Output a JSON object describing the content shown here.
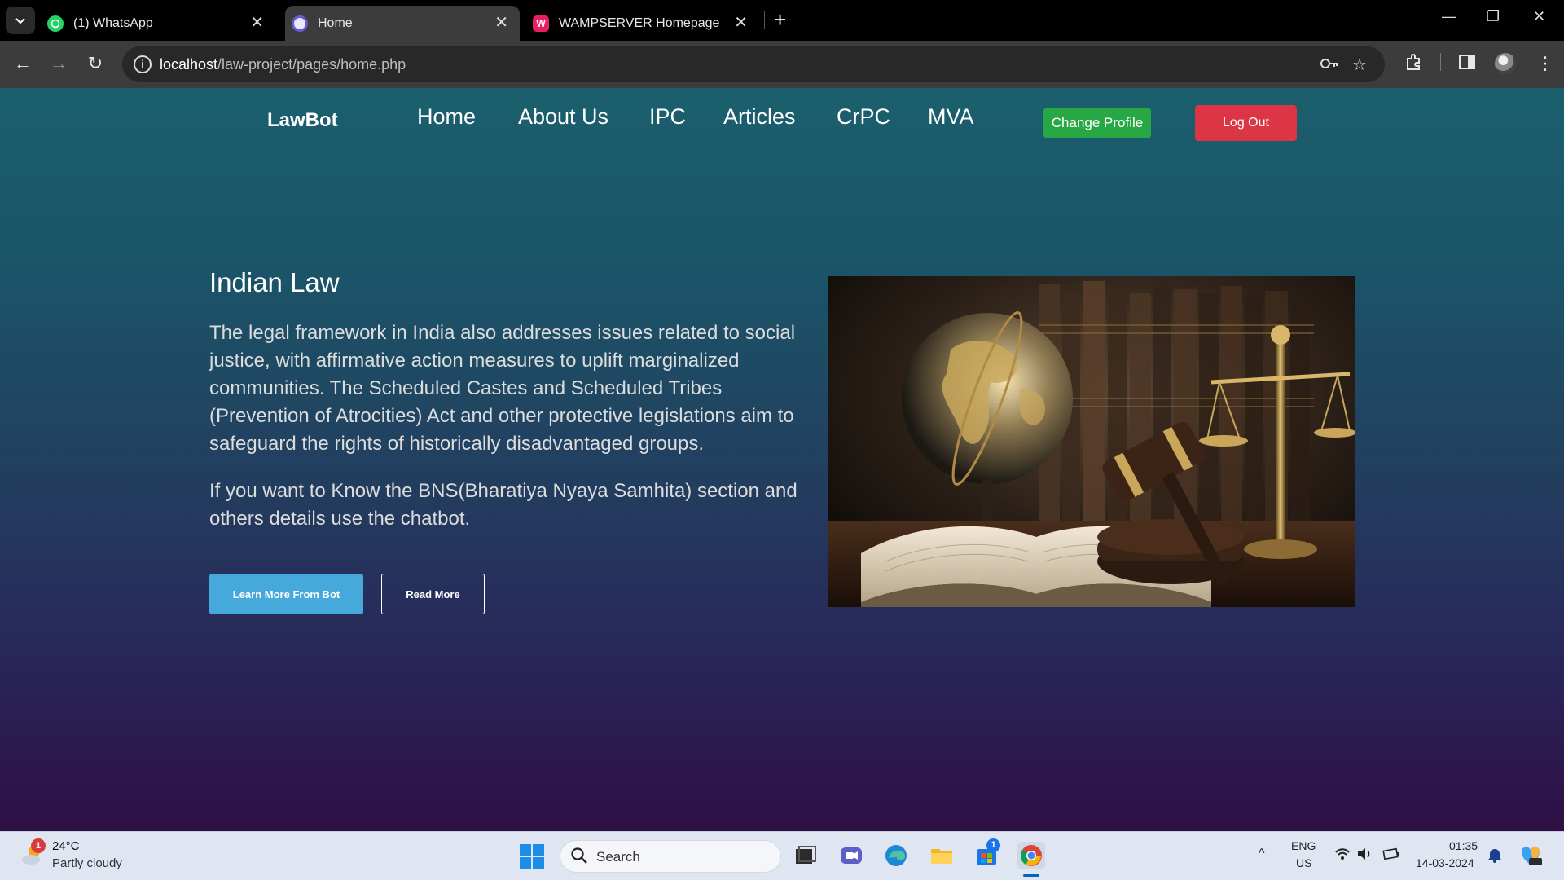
{
  "browser": {
    "tabs": [
      {
        "title": "(1) WhatsApp"
      },
      {
        "title": "Home"
      },
      {
        "title": "WAMPSERVER Homepage"
      }
    ],
    "url_host": "localhost",
    "url_path": "/law-project/pages/home.php"
  },
  "navbar": {
    "brand": "LawBot",
    "links": [
      "Home",
      "About Us",
      "IPC",
      "Articles",
      "CrPC",
      "MVA"
    ],
    "change_profile": "Change Profile",
    "logout": "Log Out"
  },
  "hero": {
    "title": "Indian Law",
    "paragraph1": "The legal framework in India also addresses issues related to social justice, with affirmative action measures to uplift marginalized communities. The Scheduled Castes and Scheduled Tribes (Prevention of Atrocities) Act and other protective legislations aim to safeguard the rights of historically disadvantaged groups.",
    "paragraph2": "If you want to Know the BNS(Bharatiya Nyaya Samhita) section and others details use the chatbot.",
    "learn_button": "Learn More From Bot",
    "read_button": "Read More"
  },
  "taskbar": {
    "weather_badge": "1",
    "temperature": "24°C",
    "condition": "Partly cloudy",
    "search_placeholder": "Search",
    "store_badge": "1",
    "lang_top": "ENG",
    "lang_bottom": "US",
    "time": "01:35",
    "date": "14-03-2024"
  },
  "colors": {
    "accent_green": "#28a745",
    "accent_red": "#dc3545",
    "accent_blue": "#45a9dc"
  }
}
